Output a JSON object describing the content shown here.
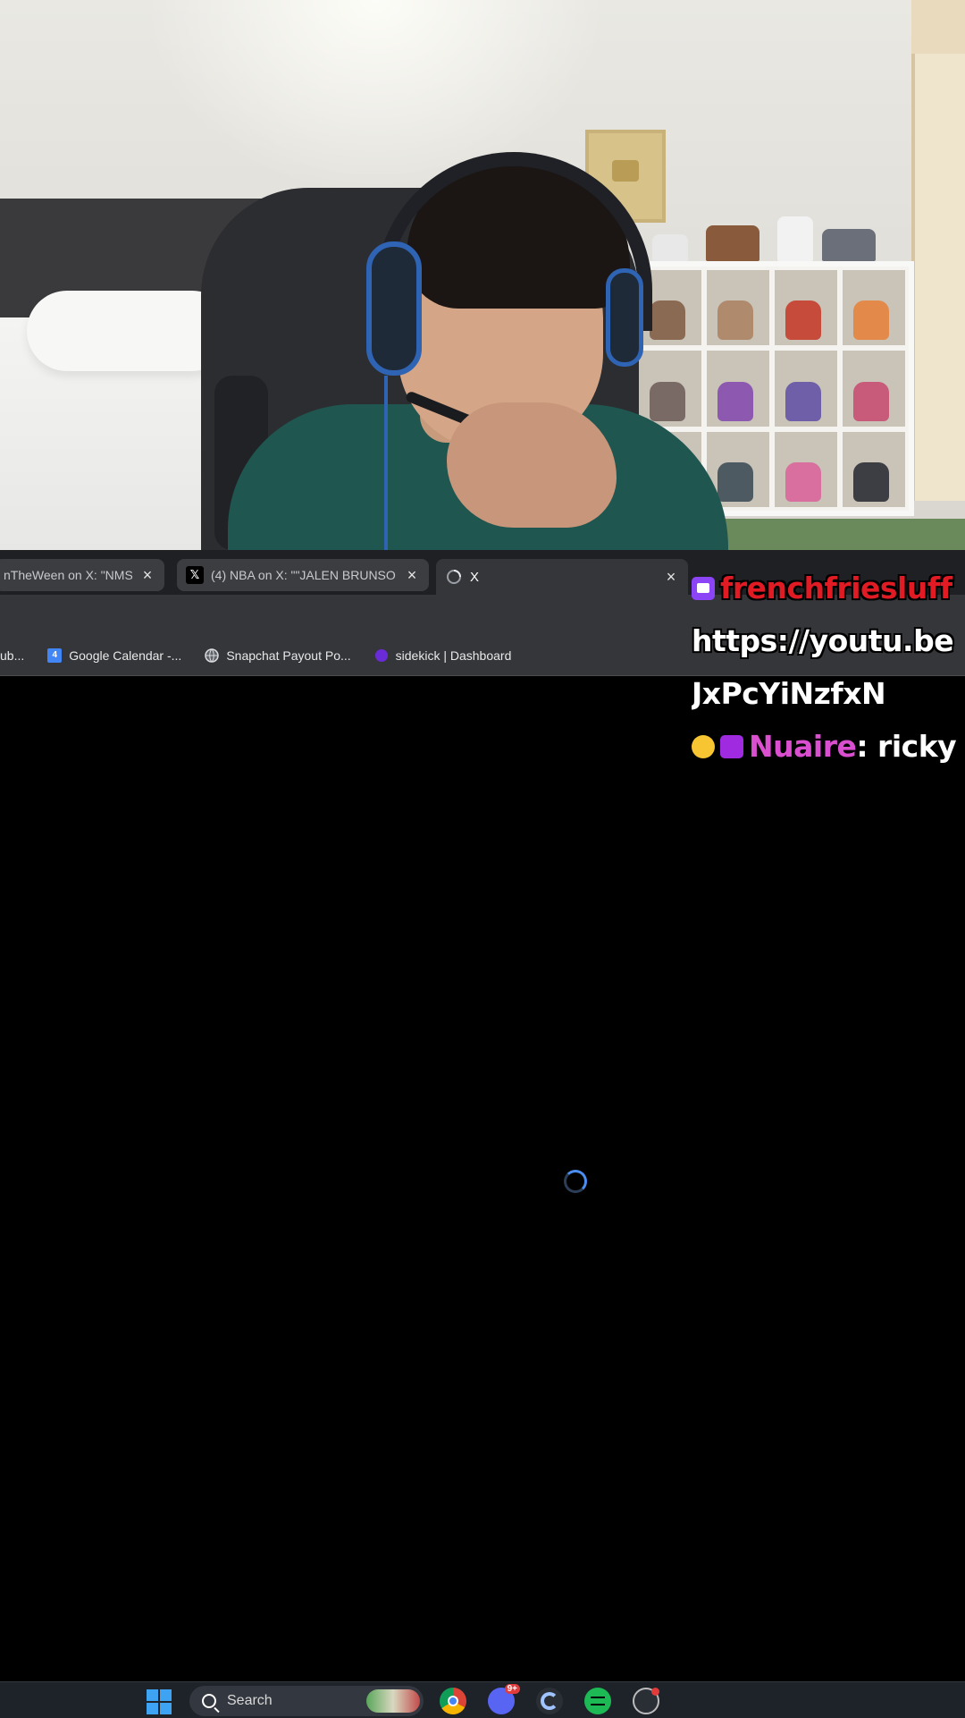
{
  "browser": {
    "tabs": [
      {
        "label": "nTheWeen on X: \"NMS",
        "favicon": "x-icon",
        "active": false
      },
      {
        "label": "(4) NBA on X: \"\"JALEN BRUNSO",
        "favicon": "x-icon",
        "active": false
      },
      {
        "label": "X",
        "favicon": "loading-icon",
        "active": true
      }
    ],
    "tab_close_glyph": "×",
    "bookmarks": [
      {
        "label": "ub...",
        "icon": "bookmark-icon"
      },
      {
        "label": "Google Calendar -...",
        "icon": "google-calendar-icon",
        "icon_text": "4"
      },
      {
        "label": "Snapchat Payout Po...",
        "icon": "globe-icon"
      },
      {
        "label": "sidekick | Dashboard",
        "icon": "sidekick-icon"
      }
    ]
  },
  "chat": {
    "messages": [
      {
        "username": "frenchfriesluff",
        "username_color": "#e01b24",
        "badges": [
          "vip-badge"
        ],
        "text": ""
      },
      {
        "username": "",
        "text": "https://youtu.be"
      },
      {
        "username": "",
        "text": "JxPcYiNzfxN"
      },
      {
        "username": "Nuaire",
        "username_color": "#d94fd0",
        "badges": [
          "chick-badge",
          "heart-badge"
        ],
        "separator": ":",
        "text": " ricky"
      }
    ]
  },
  "taskbar": {
    "search_label": "Search",
    "discord_badge": "9+",
    "apps": [
      "start-icon",
      "search-icon",
      "chrome-icon",
      "discord-icon",
      "c-app-icon",
      "spotify-icon",
      "misc-app-icon"
    ]
  },
  "colors": {
    "tabbar": "#1f2023",
    "toolbar": "#35363a",
    "spinner": "#4b8ef2",
    "taskbar": "#1e2229"
  }
}
